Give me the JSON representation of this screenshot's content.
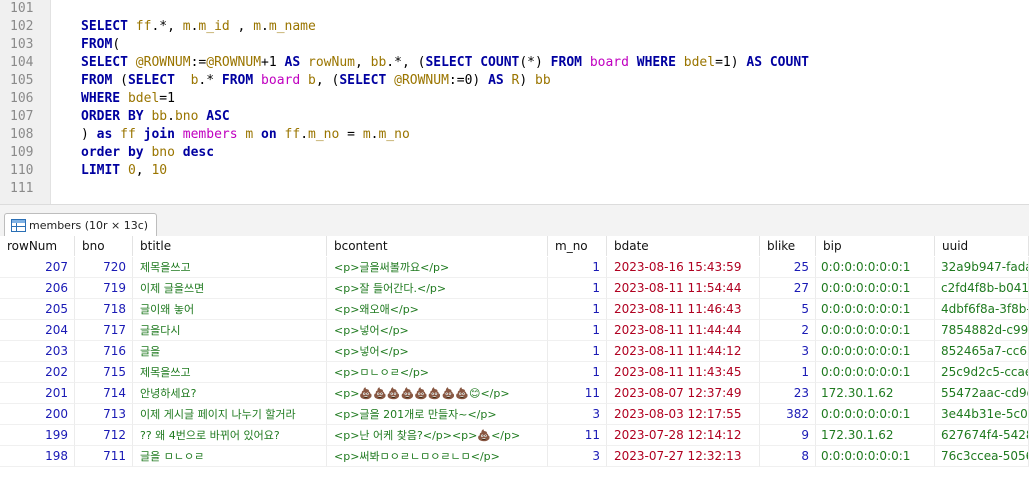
{
  "editor": {
    "lines": [
      {
        "n": "101",
        "tokens": []
      },
      {
        "n": "102",
        "tokens": [
          [
            "kw",
            "SELECT "
          ],
          [
            "id",
            "ff"
          ],
          [
            "pl",
            ".*, "
          ],
          [
            "id",
            "m"
          ],
          [
            "pl",
            "."
          ],
          [
            "id",
            "m_id"
          ],
          [
            "pl",
            " , "
          ],
          [
            "id",
            "m"
          ],
          [
            "pl",
            "."
          ],
          [
            "id",
            "m_name"
          ]
        ]
      },
      {
        "n": "103",
        "tokens": [
          [
            "kw",
            "FROM"
          ],
          [
            "pl",
            "("
          ]
        ]
      },
      {
        "n": "104",
        "tokens": [
          [
            "kw",
            "SELECT "
          ],
          [
            "id",
            "@ROWNUM"
          ],
          [
            "pl",
            ":="
          ],
          [
            "id",
            "@ROWNUM"
          ],
          [
            "pl",
            "+1 "
          ],
          [
            "kw",
            "AS "
          ],
          [
            "id",
            "rowNum"
          ],
          [
            "pl",
            ", "
          ],
          [
            "id",
            "bb"
          ],
          [
            "pl",
            ".*, ("
          ],
          [
            "kw",
            "SELECT COUNT"
          ],
          [
            "pl",
            "(*) "
          ],
          [
            "kw",
            "FROM "
          ],
          [
            "tb",
            "board "
          ],
          [
            "kw",
            "WHERE "
          ],
          [
            "id",
            "bdel"
          ],
          [
            "pl",
            "=1) "
          ],
          [
            "kw",
            "AS COUNT"
          ]
        ]
      },
      {
        "n": "105",
        "tokens": [
          [
            "kw",
            "FROM "
          ],
          [
            "pl",
            "("
          ],
          [
            "kw",
            "SELECT  "
          ],
          [
            "id",
            "b"
          ],
          [
            "pl",
            ".* "
          ],
          [
            "kw",
            "FROM "
          ],
          [
            "tb",
            "board "
          ],
          [
            "id",
            "b"
          ],
          [
            "pl",
            ", ("
          ],
          [
            "kw",
            "SELECT "
          ],
          [
            "id",
            "@ROWNUM"
          ],
          [
            "pl",
            ":=0) "
          ],
          [
            "kw",
            "AS "
          ],
          [
            "id",
            "R"
          ],
          [
            "pl",
            ") "
          ],
          [
            "id",
            "bb"
          ]
        ]
      },
      {
        "n": "106",
        "tokens": [
          [
            "kw",
            "WHERE "
          ],
          [
            "id",
            "bdel"
          ],
          [
            "pl",
            "=1"
          ]
        ]
      },
      {
        "n": "107",
        "tokens": [
          [
            "kw",
            "ORDER BY "
          ],
          [
            "id",
            "bb"
          ],
          [
            "pl",
            "."
          ],
          [
            "id",
            "bno "
          ],
          [
            "kw",
            "ASC"
          ]
        ]
      },
      {
        "n": "108",
        "tokens": [
          [
            "pl",
            ") "
          ],
          [
            "kw",
            "as "
          ],
          [
            "id",
            "ff "
          ],
          [
            "kw",
            "join "
          ],
          [
            "tb",
            "members "
          ],
          [
            "id",
            "m "
          ],
          [
            "kw",
            "on "
          ],
          [
            "id",
            "ff"
          ],
          [
            "pl",
            "."
          ],
          [
            "id",
            "m_no"
          ],
          [
            "pl",
            " = "
          ],
          [
            "id",
            "m"
          ],
          [
            "pl",
            "."
          ],
          [
            "id",
            "m_no"
          ]
        ]
      },
      {
        "n": "109",
        "tokens": [
          [
            "kw",
            "order by "
          ],
          [
            "id",
            "bno "
          ],
          [
            "kw",
            "desc"
          ]
        ]
      },
      {
        "n": "110",
        "tokens": [
          [
            "kw",
            "LIMIT "
          ],
          [
            "id",
            "0"
          ],
          [
            "pl",
            ", "
          ],
          [
            "id",
            "10"
          ]
        ]
      },
      {
        "n": "111",
        "tokens": []
      }
    ]
  },
  "result_tab": {
    "label": "members (10r × 13c)"
  },
  "grid": {
    "columns": [
      "rowNum",
      "bno",
      "btitle",
      "bcontent",
      "m_no",
      "bdate",
      "blike",
      "bip",
      "uuid"
    ],
    "rows": [
      [
        "207",
        "720",
        "제목을쓰고",
        "<p>글을써볼까요</p>",
        "1",
        "2023-08-16 15:43:59",
        "25",
        "0:0:0:0:0:0:0:1",
        "32a9b947-fada-"
      ],
      [
        "206",
        "719",
        "이제 글을쓰면",
        "<p>잘 들어간다.</p>",
        "1",
        "2023-08-11 11:54:44",
        "27",
        "0:0:0:0:0:0:0:1",
        "c2fd4f8b-b041-"
      ],
      [
        "205",
        "718",
        "글이왜 놓어",
        "<p>왜오애</p>",
        "1",
        "2023-08-11 11:46:43",
        "5",
        "0:0:0:0:0:0:0:1",
        "4dbf6f8a-3f8b-"
      ],
      [
        "204",
        "717",
        "글을다시",
        "<p>넣어</p>",
        "1",
        "2023-08-11 11:44:44",
        "2",
        "0:0:0:0:0:0:0:1",
        "7854882d-c99a"
      ],
      [
        "203",
        "716",
        "글을",
        "<p>넣어</p>",
        "1",
        "2023-08-11 11:44:12",
        "3",
        "0:0:0:0:0:0:0:1",
        "852465a7-cc65"
      ],
      [
        "202",
        "715",
        "제목을쓰고",
        "<p>ㅁㄴㅇㄹ</p>",
        "1",
        "2023-08-11 11:43:45",
        "1",
        "0:0:0:0:0:0:0:1",
        "25c9d2c5-ccae"
      ],
      [
        "201",
        "714",
        "안녕하세요?",
        "<p>💩💩💩💩💩💩💩💩😊</p>",
        "11",
        "2023-08-07 12:37:49",
        "23",
        "172.30.1.62",
        "55472aac-cd9d"
      ],
      [
        "200",
        "713",
        "이제 게시글 페이지 나누기 할거라",
        "<p>글을 201개로 만들자~</p>",
        "3",
        "2023-08-03 12:17:55",
        "382",
        "0:0:0:0:0:0:0:1",
        "3e44b31e-5c05"
      ],
      [
        "199",
        "712",
        "?? 왜 4번으로 바뀌어 있어요?",
        "<p>난 어케 찾음?</p><p>💩</p>",
        "11",
        "2023-07-28 12:14:12",
        "9",
        "172.30.1.62",
        "627674f4-5428"
      ],
      [
        "198",
        "711",
        "글을 ㅁㄴㅇㄹ",
        "<p>써봐ㅁㅇㄹㄴㅁㅇㄹㄴㅁ</p>",
        "3",
        "2023-07-27 12:32:13",
        "8",
        "0:0:0:0:0:0:0:1",
        "76c3ccea-5056"
      ]
    ]
  }
}
